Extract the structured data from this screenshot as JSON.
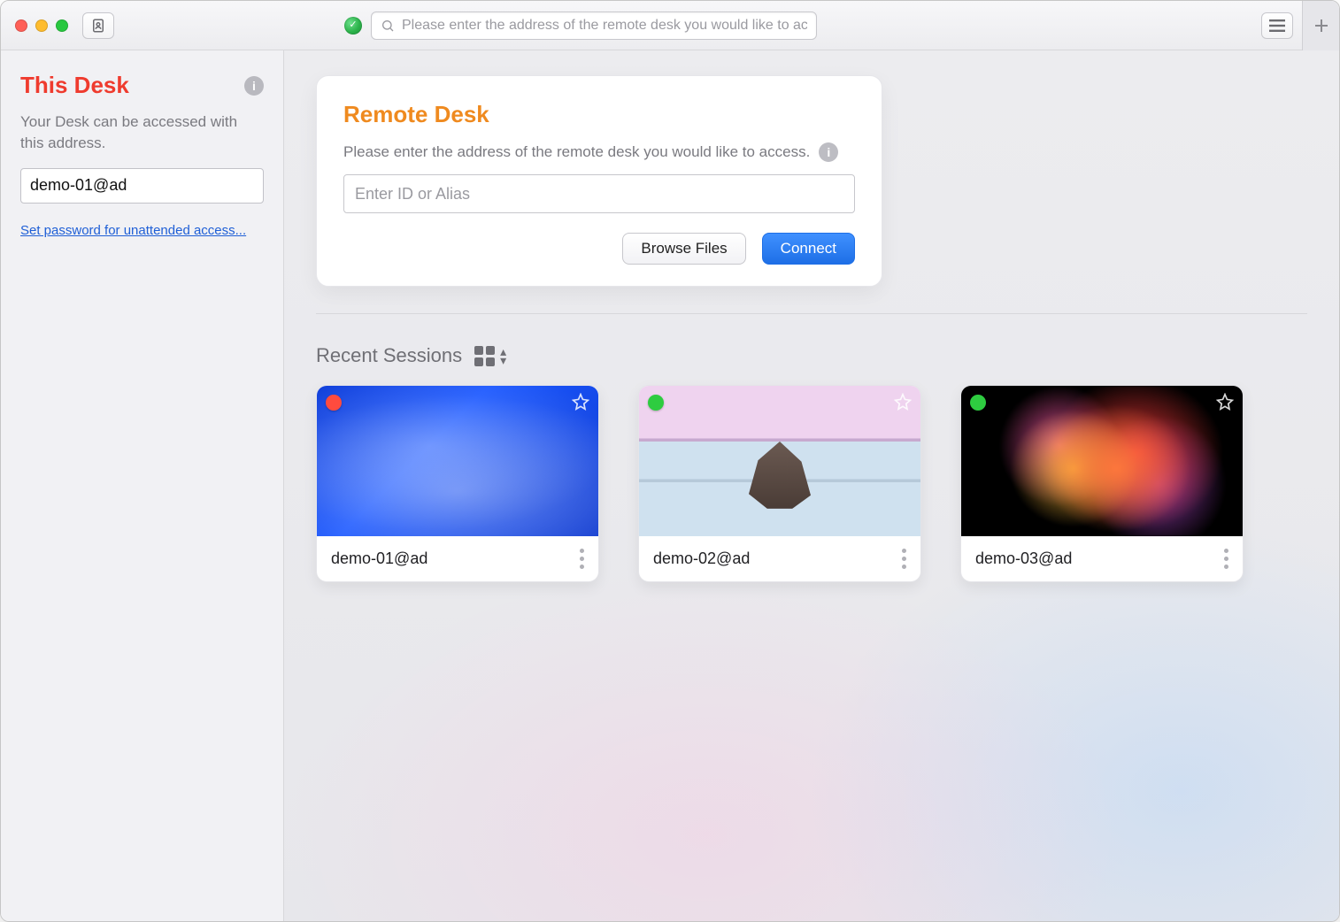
{
  "toolbar": {
    "search_placeholder": "Please enter the address of the remote desk you would like to access."
  },
  "sidebar": {
    "title": "This Desk",
    "description": "Your Desk can be accessed with this address.",
    "address_value": "demo-01@ad",
    "password_link": "Set password for unattended access..."
  },
  "remote": {
    "title": "Remote Desk",
    "description": "Please enter the address of the remote desk you would like to access.",
    "input_placeholder": "Enter ID or Alias",
    "browse_label": "Browse Files",
    "connect_label": "Connect"
  },
  "recent": {
    "heading": "Recent Sessions",
    "items": [
      {
        "name": "demo-01@ad",
        "status": "offline",
        "thumb": "blue"
      },
      {
        "name": "demo-02@ad",
        "status": "online",
        "thumb": "pink"
      },
      {
        "name": "demo-03@ad",
        "status": "online",
        "thumb": "dark"
      }
    ]
  },
  "colors": {
    "accent_red": "#ef3b2e",
    "accent_orange": "#ef8a1f",
    "primary_blue": "#1e6fe6"
  }
}
